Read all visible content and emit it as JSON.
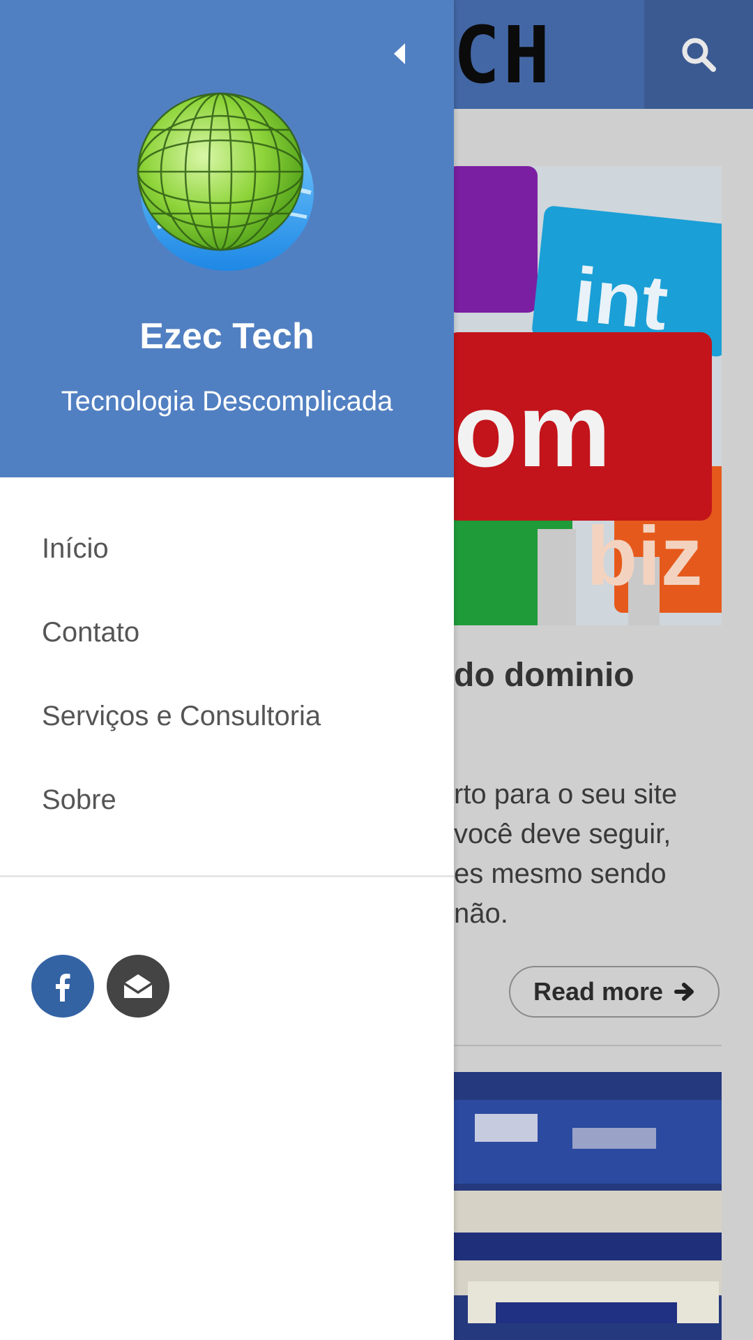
{
  "header": {
    "logo_text": "CH",
    "search_icon": "search-icon"
  },
  "post": {
    "title": "do dominio",
    "excerpt_lines": [
      "rto para o seu site",
      "você deve seguir,",
      "es mesmo sendo",
      "não."
    ],
    "read_more_label": "Read more",
    "read_more_icon": "arrow-right-icon"
  },
  "drawer": {
    "collapse_icon": "caret-left-icon",
    "logo_icon": "globe-icon",
    "site_name": "Ezec Tech",
    "tagline": "Tecnologia Descomplicada",
    "menu": [
      {
        "label": "Início"
      },
      {
        "label": "Contato"
      },
      {
        "label": "Serviços e Consultoria"
      },
      {
        "label": "Sobre"
      }
    ],
    "social": [
      {
        "icon": "facebook-icon",
        "color": "#3463a4"
      },
      {
        "icon": "email-icon",
        "color": "#444444"
      }
    ]
  },
  "colors": {
    "drawer_header": "#5180c2",
    "topbar": "#4367a5",
    "search_button": "#3a5a91"
  }
}
